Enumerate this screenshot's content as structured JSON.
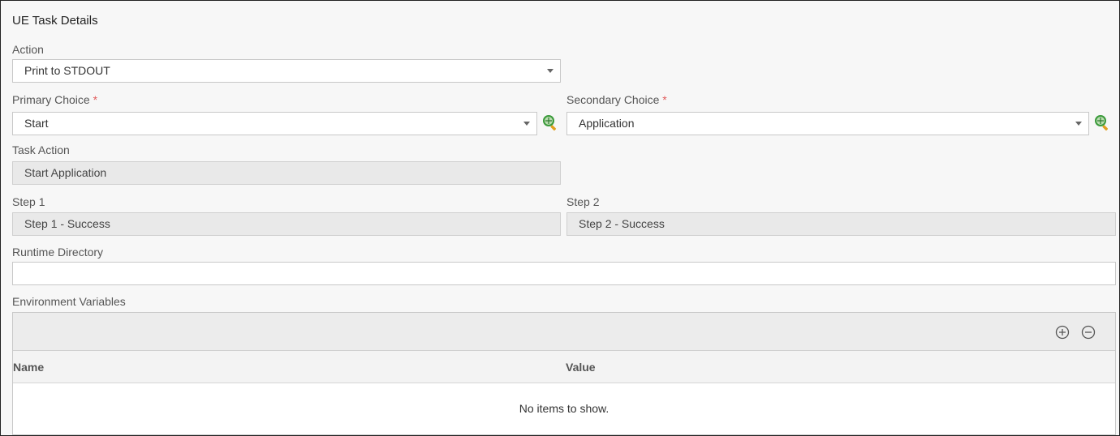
{
  "panel": {
    "title": "UE Task Details"
  },
  "action": {
    "label": "Action",
    "value": "Print to STDOUT"
  },
  "primary_choice": {
    "label": "Primary Choice",
    "required_mark": "*",
    "value": "Start"
  },
  "secondary_choice": {
    "label": "Secondary Choice",
    "required_mark": "*",
    "value": "Application"
  },
  "task_action": {
    "label": "Task Action",
    "value": "Start Application"
  },
  "step1": {
    "label": "Step 1",
    "value": "Step 1 - Success"
  },
  "step2": {
    "label": "Step 2",
    "value": "Step 2 - Success"
  },
  "runtime_directory": {
    "label": "Runtime Directory",
    "value": ""
  },
  "env_vars": {
    "label": "Environment Variables",
    "columns": [
      "Name",
      "Value"
    ],
    "empty_text": "No items to show.",
    "add_icon": "plus-circle-icon",
    "remove_icon": "minus-circle-icon"
  },
  "colors": {
    "required": "#e05a5a",
    "readonly_bg": "#e9e9e9",
    "lookup_icon": "#3a9a3a"
  }
}
